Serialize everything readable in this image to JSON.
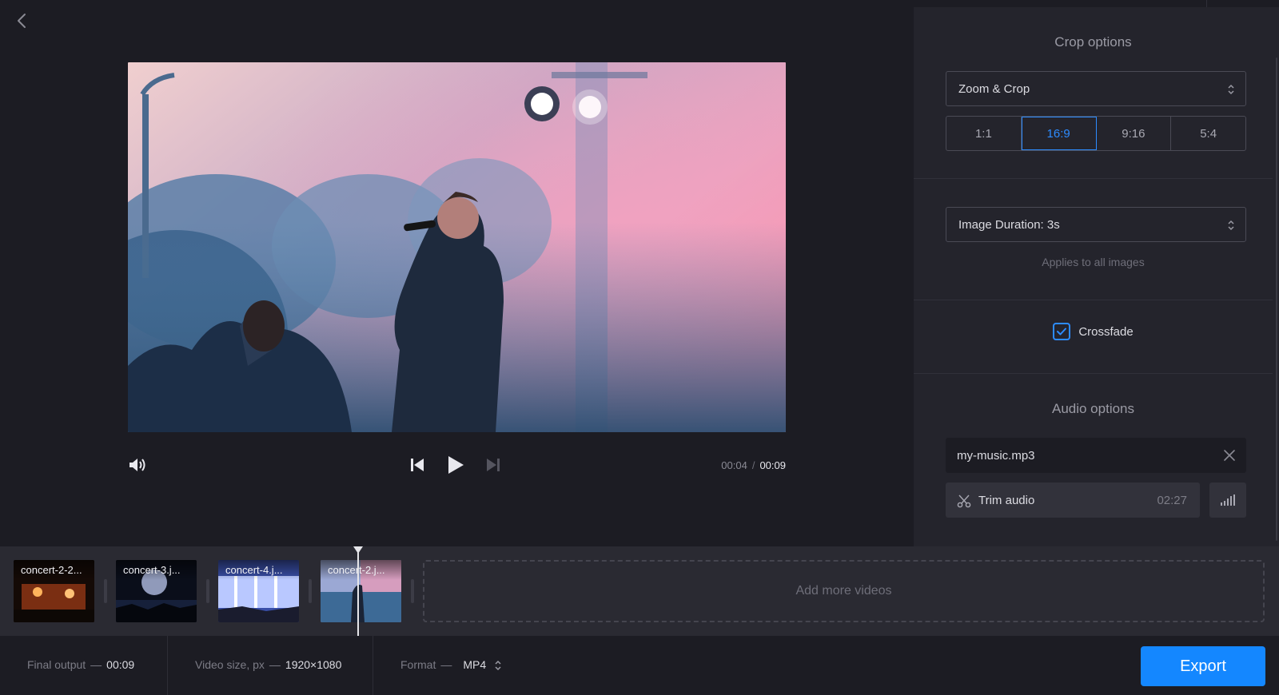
{
  "preview": {
    "current_time": "00:04",
    "total_time": "00:09",
    "time_separator": "/",
    "icons": [
      "chevron-left-icon",
      "volume-icon",
      "skip-back-icon",
      "play-icon",
      "skip-forward-icon"
    ]
  },
  "crop": {
    "title": "Crop options",
    "mode": "Zoom & Crop",
    "ratios": [
      "1:1",
      "16:9",
      "9:16",
      "5:4"
    ],
    "active_ratio": "16:9"
  },
  "duration": {
    "value": "Image Duration: 3s",
    "hint": "Applies to all images"
  },
  "crossfade": {
    "label": "Crossfade",
    "checked": true
  },
  "audio": {
    "title": "Audio options",
    "file": "my-music.mp3",
    "trim_label": "Trim audio",
    "trim_duration": "02:27"
  },
  "timeline": {
    "clips": [
      {
        "name": "concert-2-2..."
      },
      {
        "name": "concert-3.j..."
      },
      {
        "name": "concert-4.j..."
      },
      {
        "name": "concert-2.j..."
      }
    ],
    "add_more": "Add more videos"
  },
  "footer": {
    "final_output_label": "Final output",
    "final_output_value": "00:09",
    "video_size_label": "Video size, px",
    "video_size_value": "1920×1080",
    "format_label": "Format",
    "format_value": "MP4",
    "dash": "—",
    "export_label": "Export"
  },
  "colors": {
    "accent": "#2d8cff",
    "export_button": "#1487ff",
    "background": "#1c1c23",
    "panel": "#24242c"
  }
}
